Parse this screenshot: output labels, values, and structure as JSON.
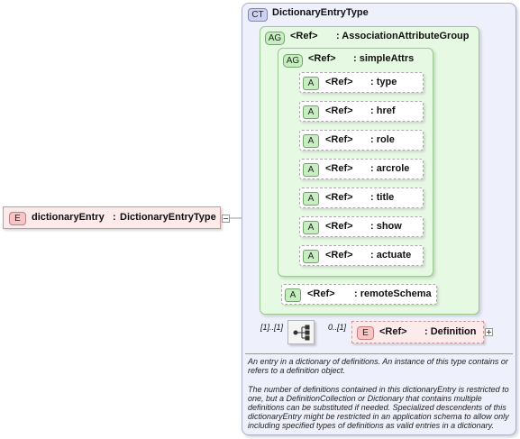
{
  "root_element": {
    "badge": "E",
    "name": "dictionaryEntry",
    "type_sep": ":",
    "type": "DictionaryEntryType"
  },
  "complex_type": {
    "badge": "CT",
    "name": "DictionaryEntryType"
  },
  "attribute_group": {
    "badge": "AG",
    "ref": "<Ref>",
    "name": ": AssociationAttributeGroup",
    "inner_group": {
      "badge": "AG",
      "ref": "<Ref>",
      "name": ": simpleAttrs",
      "attributes": [
        {
          "badge": "A",
          "ref": "<Ref>",
          "name": ": type"
        },
        {
          "badge": "A",
          "ref": "<Ref>",
          "name": ": href"
        },
        {
          "badge": "A",
          "ref": "<Ref>",
          "name": ": role"
        },
        {
          "badge": "A",
          "ref": "<Ref>",
          "name": ": arcrole"
        },
        {
          "badge": "A",
          "ref": "<Ref>",
          "name": ": title"
        },
        {
          "badge": "A",
          "ref": "<Ref>",
          "name": ": show"
        },
        {
          "badge": "A",
          "ref": "<Ref>",
          "name": ": actuate"
        }
      ]
    },
    "remote_schema": {
      "badge": "A",
      "ref": "<Ref>",
      "name": ": remoteSchema"
    }
  },
  "sequence": {
    "cardinality": "[1]..[1]",
    "child_cardinality": "0..[1]",
    "child": {
      "badge": "E",
      "ref": "<Ref>",
      "name": ": Definition"
    }
  },
  "description": {
    "para1": "An entry in a dictionary of definitions. An instance of this type contains or refers to a definition object.",
    "para2": "The number of definitions contained in this dictionaryEntry is restricted to one, but a DefinitionCollection or Dictionary that contains multiple definitions can be substituted if needed. Specialized descendents of this dictionaryEntry might be restricted in an application schema to allow only including specified types of definitions as valid entries in a dictionary."
  },
  "colors": {
    "ct_background": "#eef0fb",
    "ag_background": "#e6f9e2",
    "element_background": "#fdeaea",
    "line_color": "#9a9a9a"
  }
}
